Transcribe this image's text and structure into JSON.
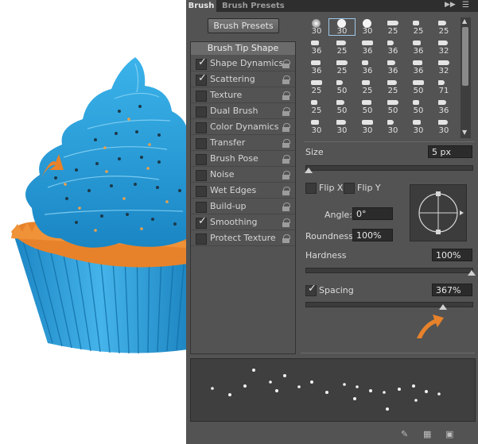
{
  "tabs": [
    "Brush",
    "Brush Presets"
  ],
  "icons": {
    "collapse": "collapse-arrows-icon",
    "menu": "panel-menu-icon"
  },
  "brush_presets_button": "Brush Presets",
  "options_header": "Brush Tip Shape",
  "options": [
    {
      "label": "Shape Dynamics",
      "checked": true
    },
    {
      "label": "Scattering",
      "checked": true
    },
    {
      "label": "Texture",
      "checked": false
    },
    {
      "label": "Dual Brush",
      "checked": false
    },
    {
      "label": "Color Dynamics",
      "checked": false
    },
    {
      "label": "Transfer",
      "checked": false
    },
    {
      "label": "Brush Pose",
      "checked": false
    },
    {
      "label": "Noise",
      "checked": false
    },
    {
      "label": "Wet Edges",
      "checked": false
    },
    {
      "label": "Build-up",
      "checked": false
    },
    {
      "label": "Smoothing",
      "checked": true
    },
    {
      "label": "Protect Texture",
      "checked": false
    }
  ],
  "brush_grid": [
    [
      "30",
      "30",
      "30",
      "25",
      "25",
      "25"
    ],
    [
      "36",
      "25",
      "36",
      "36",
      "36",
      "32"
    ],
    [
      "36",
      "25",
      "36",
      "36",
      "36",
      "32"
    ],
    [
      "25",
      "50",
      "25",
      "25",
      "50",
      "71"
    ],
    [
      "25",
      "50",
      "50",
      "50",
      "50",
      "36"
    ],
    [
      "30",
      "30",
      "30",
      "30",
      "30",
      "30"
    ]
  ],
  "size": {
    "label": "Size",
    "value": "5 px"
  },
  "flip_x": "Flip X",
  "flip_y": "Flip Y",
  "angle": {
    "label": "Angle:",
    "value": "0°"
  },
  "roundness": {
    "label": "Roundness:",
    "value": "100%"
  },
  "hardness": {
    "label": "Hardness",
    "value": "100%"
  },
  "spacing": {
    "label": "Spacing",
    "value": "367%",
    "checked": true
  },
  "sliders": {
    "size": 0.02,
    "hardness": 1.0,
    "spacing": 0.83
  },
  "colors": {
    "panel": "#535353",
    "dark": "#2e2e2e",
    "accent_orange": "#e8822a",
    "frosting_blue": "#2aa3dc"
  },
  "footer_icons": [
    "toggle-live-tip-icon",
    "grid-icon",
    "new-brush-icon"
  ]
}
